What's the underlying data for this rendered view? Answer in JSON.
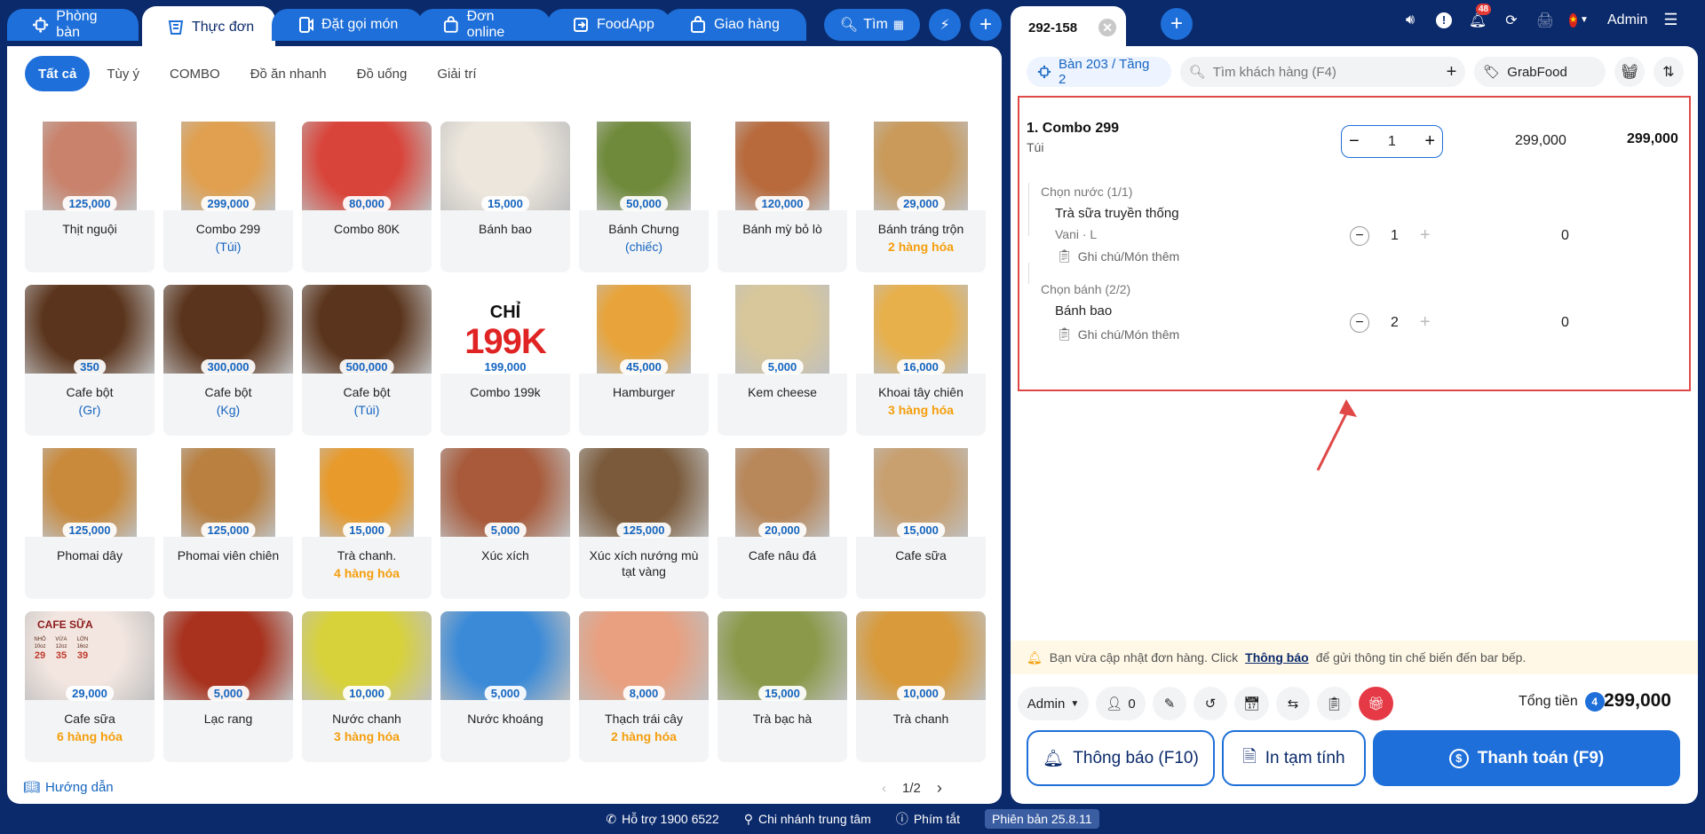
{
  "top_tabs": [
    {
      "label": "Phòng bàn",
      "icon": "table-icon"
    },
    {
      "label": "Thực đơn",
      "icon": "menu-icon"
    },
    {
      "label": "Đặt gọi món",
      "icon": "order-call-icon"
    },
    {
      "label": "Đơn online",
      "icon": "bag-icon"
    },
    {
      "label": "FoodApp",
      "icon": "login-icon"
    },
    {
      "label": "Giao hàng",
      "icon": "bag-icon"
    }
  ],
  "top_search_label": "Tìm",
  "categories": [
    "Tất cả",
    "Tùy ý",
    "COMBO",
    "Đồ ăn nhanh",
    "Đồ uống",
    "Giải trí"
  ],
  "products": [
    {
      "name": "Thịt nguội",
      "price": "125,000",
      "sub": "",
      "sub_type": "",
      "color": "#c9826b"
    },
    {
      "name": "Combo 299",
      "price": "299,000",
      "sub": "(Túi)",
      "sub_type": "unit",
      "color": "#e0a050"
    },
    {
      "name": "Combo 80K",
      "price": "80,000",
      "sub": "",
      "sub_type": "",
      "color": "#d9443a"
    },
    {
      "name": "Bánh bao",
      "price": "15,000",
      "sub": "",
      "sub_type": "",
      "color": "#ece6dc"
    },
    {
      "name": "Bánh Chưng",
      "price": "50,000",
      "sub": "(chiếc)",
      "sub_type": "unit",
      "color": "#6f8a3a"
    },
    {
      "name": "Bánh mỳ bỏ lò",
      "price": "120,000",
      "sub": "",
      "sub_type": "",
      "color": "#b86a3c"
    },
    {
      "name": "Bánh tráng trộn",
      "price": "29,000",
      "sub": "2 hàng hóa",
      "sub_type": "variant",
      "color": "#c99a5a"
    },
    {
      "name": "Cafe bột",
      "price": "350",
      "sub": "(Gr)",
      "sub_type": "unit",
      "color": "#5a341c"
    },
    {
      "name": "Cafe bột",
      "price": "300,000",
      "sub": "(Kg)",
      "sub_type": "unit",
      "color": "#5a341c"
    },
    {
      "name": "Cafe bột",
      "price": "500,000",
      "sub": "(Túi)",
      "sub_type": "unit",
      "color": "#5a341c"
    },
    {
      "name": "Combo 199k",
      "price": "199,000",
      "sub": "",
      "sub_type": "",
      "color": "#ffffff"
    },
    {
      "name": "Hamburger",
      "price": "45,000",
      "sub": "",
      "sub_type": "",
      "color": "#e8a43a"
    },
    {
      "name": "Kem cheese",
      "price": "5,000",
      "sub": "",
      "sub_type": "",
      "color": "#d8c79a"
    },
    {
      "name": "Khoai tây chiên",
      "price": "16,000",
      "sub": "3 hàng hóa",
      "sub_type": "variant",
      "color": "#e8b04a"
    },
    {
      "name": "Phomai dây",
      "price": "125,000",
      "sub": "",
      "sub_type": "",
      "color": "#c98a3c"
    },
    {
      "name": "Phomai viên chiên",
      "price": "125,000",
      "sub": "",
      "sub_type": "",
      "color": "#b98040"
    },
    {
      "name": "Trà chanh.",
      "price": "15,000",
      "sub": "4 hàng hóa",
      "sub_type": "variant",
      "color": "#e89a2a"
    },
    {
      "name": "Xúc xích",
      "price": "5,000",
      "sub": "",
      "sub_type": "",
      "color": "#a85a3a"
    },
    {
      "name": "Xúc xích nướng mù tạt vàng",
      "price": "125,000",
      "sub": "",
      "sub_type": "",
      "color": "#7a5a3a"
    },
    {
      "name": "Cafe nâu đá",
      "price": "20,000",
      "sub": "",
      "sub_type": "",
      "color": "#b8875a"
    },
    {
      "name": "Cafe sữa",
      "price": "15,000",
      "sub": "",
      "sub_type": "",
      "color": "#c8a070"
    },
    {
      "name": "Cafe sữa",
      "price": "29,000",
      "sub": "6 hàng hóa",
      "sub_type": "variant",
      "color": "#f3e6e0"
    },
    {
      "name": "Lạc rang",
      "price": "5,000",
      "sub": "",
      "sub_type": "",
      "color": "#a8321e"
    },
    {
      "name": "Nước chanh",
      "price": "10,000",
      "sub": "3 hàng hóa",
      "sub_type": "variant",
      "color": "#d8d23a"
    },
    {
      "name": "Nước khoáng",
      "price": "5,000",
      "sub": "",
      "sub_type": "",
      "color": "#3a8ad8"
    },
    {
      "name": "Thạch trái cây",
      "price": "8,000",
      "sub": "2 hàng hóa",
      "sub_type": "variant",
      "color": "#e8a080"
    },
    {
      "name": "Trà bạc hà",
      "price": "15,000",
      "sub": "",
      "sub_type": "",
      "color": "#8a9a4a"
    },
    {
      "name": "Trà chanh",
      "price": "10,000",
      "sub": "",
      "sub_type": "",
      "color": "#d89a3a"
    }
  ],
  "combo_199k_overlay": {
    "top": "CHỈ",
    "big": "199K"
  },
  "cafe_sua_overlay": {
    "title": "CAFE SỮA",
    "sizes": [
      "NHỎ",
      "VỪA",
      "LỚN"
    ],
    "size_notes": [
      "10oz",
      "12oz",
      "16oz"
    ],
    "size_prices": [
      "29",
      "35",
      "39"
    ]
  },
  "guide_label": "Hướng dẫn",
  "pager": {
    "label": "1/2"
  },
  "order": {
    "id": "292-158",
    "table": "Bàn 203 / Tầng 2",
    "customer_placeholder": "Tìm khách hàng (F4)",
    "source": "GrabFood",
    "line": {
      "name": "1. Combo 299",
      "unit": "Túi",
      "qty": "1",
      "price": "299,000",
      "total": "299,000"
    },
    "groups": [
      {
        "title": "Chọn nước (1/1)",
        "item": "Trà sữa truyền thống",
        "attrs": "Vani · L",
        "note": "Ghi chú/Món thêm",
        "qty": "1",
        "amount": "0"
      },
      {
        "title": "Chọn bánh (2/2)",
        "item": "Bánh bao",
        "attrs": "",
        "note": "Ghi chú/Món thêm",
        "qty": "2",
        "amount": "0"
      }
    ],
    "notice_before": "Bạn vừa cập nhật đơn hàng. Click",
    "notice_link": "Thông báo",
    "notice_after": "để gửi thông tin chế biến đến bar bếp.",
    "staff": "Admin",
    "guest_count": "0",
    "total_label": "Tổng tiền",
    "total_count": "4",
    "total": "299,000",
    "btn_notify": "Thông báo (F10)",
    "btn_print": "In tạm tính",
    "btn_pay": "Thanh toán (F9)"
  },
  "header": {
    "user": "Admin",
    "notif_count": "48"
  },
  "footer": {
    "support": "Hỗ trợ 1900 6522",
    "branch": "Chi nhánh trung tâm",
    "shortcuts": "Phím tắt",
    "version": "Phiên bản 25.8.11"
  },
  "colors": {
    "brand": "#1e6fd9",
    "navy": "#0b2a6b",
    "variant": "#f59e0b",
    "danger": "#e04848"
  }
}
